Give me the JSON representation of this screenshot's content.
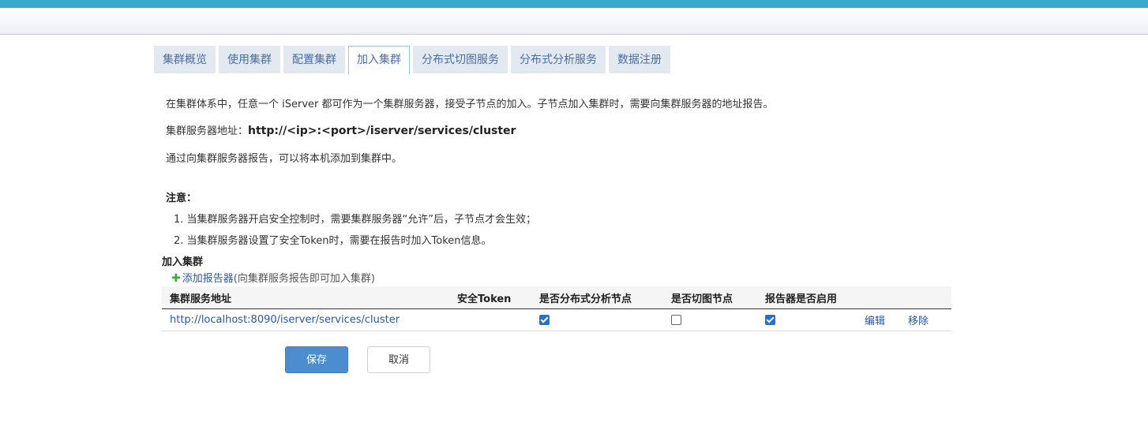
{
  "tabs": [
    {
      "label": "集群概览",
      "active": false
    },
    {
      "label": "使用集群",
      "active": false
    },
    {
      "label": "配置集群",
      "active": false
    },
    {
      "label": "加入集群",
      "active": true
    },
    {
      "label": "分布式切图服务",
      "active": false
    },
    {
      "label": "分布式分析服务",
      "active": false
    },
    {
      "label": "数据注册",
      "active": false
    }
  ],
  "intro": {
    "line1": "在集群体系中，任意一个 iServer 都可作为一个集群服务器，接受子节点的加入。子节点加入集群时，需要向集群服务器的地址报告。",
    "address_label": "集群服务器地址：",
    "address_value": "http://<ip>:<port>/iserver/services/cluster",
    "line3": "通过向集群服务器报告，可以将本机添加到集群中。"
  },
  "notes": {
    "title": "注意：",
    "items": [
      "1. 当集群服务器开启安全控制时，需要集群服务器“允许”后，子节点才会生效；",
      "2. 当集群服务器设置了安全Token时，需要在报告时加入Token信息。"
    ]
  },
  "join": {
    "title": "加入集群",
    "add_link": "添加报告器",
    "add_hint": "(向集群服务报告即可加入集群)"
  },
  "table": {
    "headers": [
      "集群服务地址",
      "安全Token",
      "是否分布式分析节点",
      "是否切图节点",
      "报告器是否启用"
    ],
    "rows": [
      {
        "url": "http://localhost:8090/iserver/services/cluster",
        "token": "",
        "analysis_node": true,
        "tile_node": false,
        "enabled": true,
        "edit": "编辑",
        "remove": "移除"
      }
    ]
  },
  "buttons": {
    "save": "保存",
    "cancel": "取消"
  },
  "colors": {
    "accent": "#3aa9cc",
    "link": "#2957a4",
    "primary_button": "#4b8dce",
    "checkbox_on": "#1f73d2"
  }
}
